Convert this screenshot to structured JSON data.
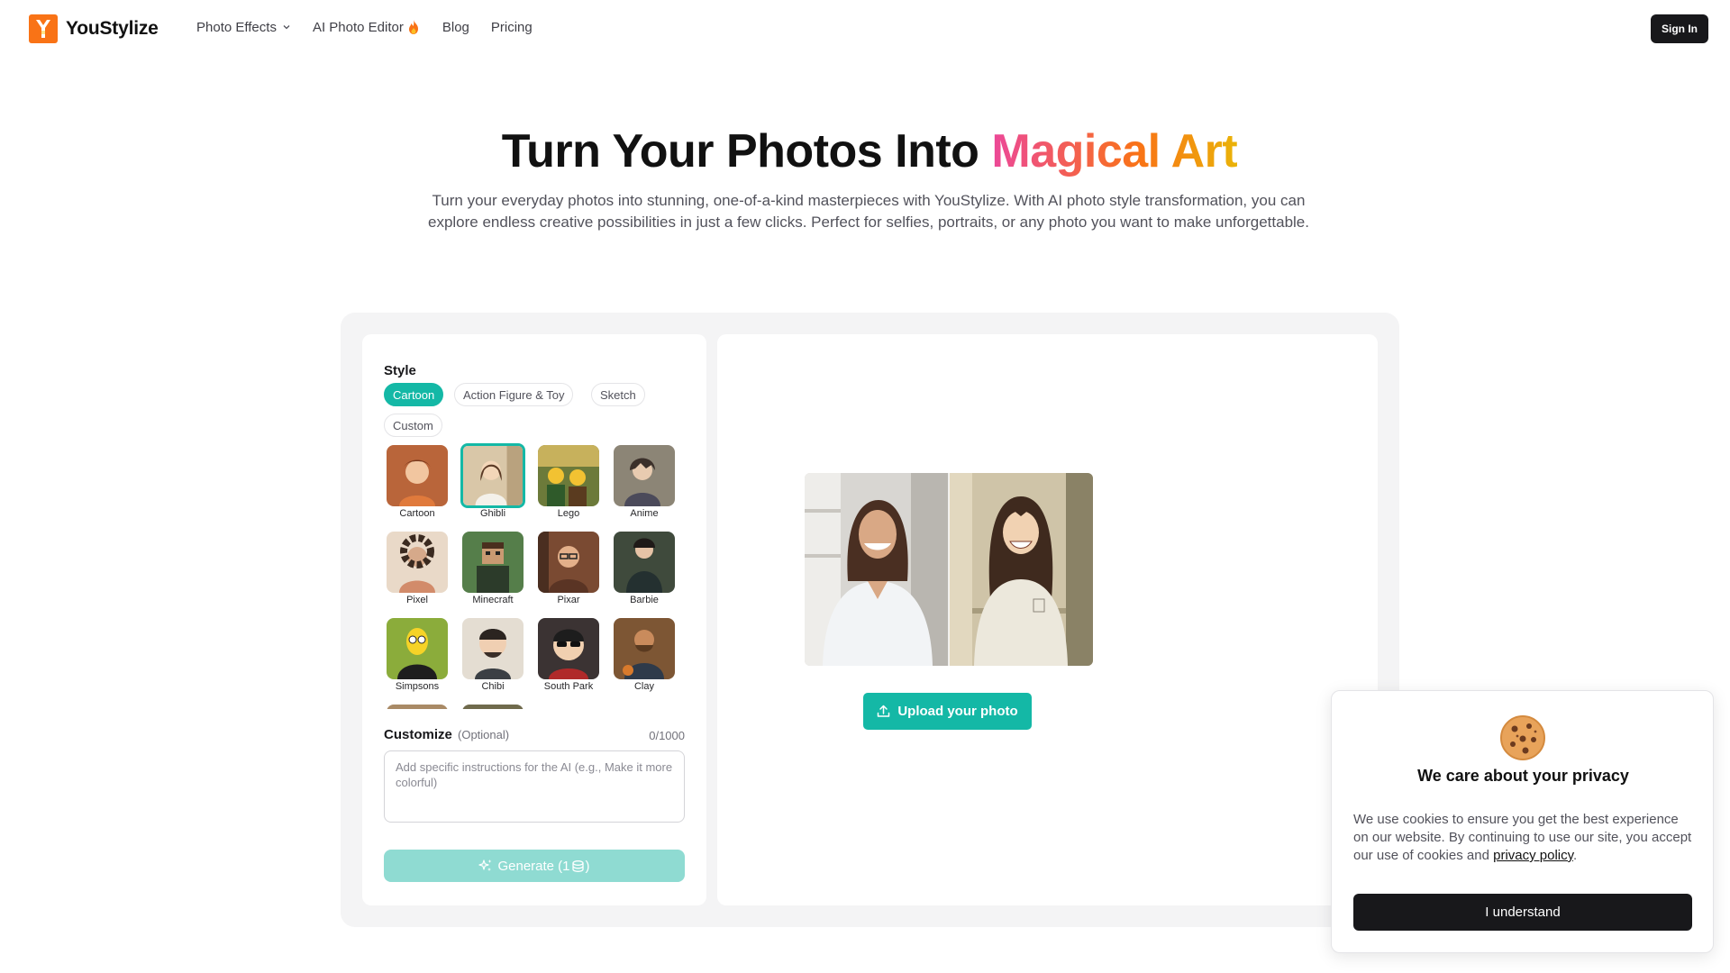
{
  "brand": {
    "name": "YouStylize",
    "accent": "#14b8a6",
    "logo_color": "#f97316"
  },
  "nav": {
    "items": [
      {
        "label": "Photo Effects",
        "icon": "chevron-down-icon"
      },
      {
        "label": "AI Photo Editor",
        "icon": "flame-icon"
      },
      {
        "label": "Blog"
      },
      {
        "label": "Pricing"
      }
    ],
    "signin_label": "Sign In"
  },
  "hero": {
    "title_main": "Turn Your Photos Into ",
    "title_highlight": "Magical Art",
    "subtitle": "Turn your everyday photos into stunning, one-of-a-kind masterpieces with YouStylize. With AI photo style transformation, you can explore endless creative possibilities in just a few clicks. Perfect for selfies, portraits, or any photo you want to make unforgettable."
  },
  "editor": {
    "style_label": "Style",
    "categories": [
      {
        "label": "Cartoon",
        "active": true
      },
      {
        "label": "Action Figure & Toy",
        "active": false
      },
      {
        "label": "Sketch",
        "active": false
      },
      {
        "label": "Custom",
        "active": false
      }
    ],
    "styles": [
      {
        "label": "Cartoon",
        "color": "#b9653a",
        "selected": false
      },
      {
        "label": "Ghibli",
        "color": "#d9c7a8",
        "selected": true
      },
      {
        "label": "Lego",
        "color": "#6c7a3a",
        "selected": false
      },
      {
        "label": "Anime",
        "color": "#8c8576",
        "selected": false
      },
      {
        "label": "Pixel",
        "color": "#d6a98a",
        "selected": false
      },
      {
        "label": "Minecraft",
        "color": "#557e4a",
        "selected": false
      },
      {
        "label": "Pixar",
        "color": "#7a4a32",
        "selected": false
      },
      {
        "label": "Barbie",
        "color": "#3f4a3c",
        "selected": false
      },
      {
        "label": "Simpsons",
        "color": "#8bac3b",
        "selected": false
      },
      {
        "label": "Chibi",
        "color": "#e4ddd2",
        "selected": false
      },
      {
        "label": "South Park",
        "color": "#3b3333",
        "selected": false
      },
      {
        "label": "Clay",
        "color": "#7d5634",
        "selected": false
      },
      {
        "label": "",
        "color": "#a98a66",
        "selected": false
      },
      {
        "label": "",
        "color": "#6f6a4c",
        "selected": false
      }
    ],
    "customize_label": "Customize",
    "customize_optional": "(Optional)",
    "customize_count": "0/1000",
    "customize_placeholder": "Add specific instructions for the AI (e.g., Make it more colorful)",
    "generate_label": "Generate (1",
    "generate_suffix": ")"
  },
  "preview": {
    "upload_label": "Upload your photo",
    "upload_icon": "upload-icon"
  },
  "cookie": {
    "icon": "cookie-icon",
    "title": "We care about your privacy",
    "text_before": "We use cookies to ensure you get the best experience on our website. By continuing to use our site, you accept our use of cookies and ",
    "link_label": "privacy policy",
    "text_after": ".",
    "button_label": "I understand"
  }
}
